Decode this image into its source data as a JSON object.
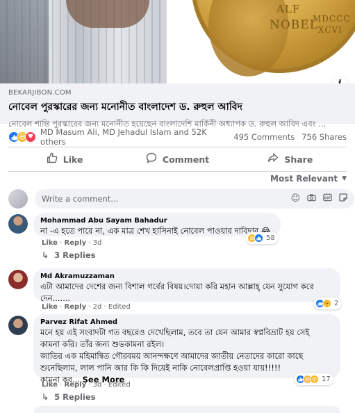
{
  "post": {
    "info_icon": "i",
    "link": {
      "domain": "BEKARJIBON.COM",
      "title": "নোবেল পুরস্কারের জন্য মনোনীত বাংলাদেশ ড. রুহুল আবিদ",
      "description": "নোবেল শান্তি পুরস্কারের জন্য মনোনীত হয়েছেন বাংলাদেশি মার্কিনী অধ্যাপক ড. রুহুল আবিদ এবং ..."
    },
    "hero": {
      "medal_text_1": "ALF",
      "medal_text_2": "NOBEL",
      "medal_text_3": "MDCCC",
      "medal_text_4": "XCVI"
    },
    "summary": {
      "names": "MD Masum Ali, MD Jehadul Islam and 52K others",
      "comments": "495 Comments",
      "shares": "756 Shares"
    },
    "actions": {
      "like": "Like",
      "comment": "Comment",
      "share": "Share"
    }
  },
  "sort": {
    "label": "Most Relevant"
  },
  "composer": {
    "placeholder": "Write a comment..."
  },
  "comments": [
    {
      "name": "Mohammad Abu Sayam Bahadur",
      "text": "না -এ হতে পারে না, এক মাত্র শেখ হাসিনাই নোবেল পাওয়ার দাবিদার 😂",
      "reactions": "58",
      "like": "Like",
      "reply": "Reply",
      "time": "3d",
      "replies": "3 Replies"
    },
    {
      "name": "Md Akramuzzaman",
      "text_line1": "এটা আমাদের দেশের জন্য বিশাল গর্বের বিষয়।দোয়া করি মহান আল্লাহ্ যেন সুযোগ করে",
      "text_line2": "দেন.......",
      "reactions": "2",
      "like": "Like",
      "reply": "Reply",
      "time": "2d",
      "edited": "Edited"
    },
    {
      "name": "Parvez Rifat Ahmed",
      "text_line1": "মনে হয় এই সংবাদটা গত বছরেও দেখেছিলাম, তবে তা যেন আমার স্বপ্নবিভ্রাট হয় সেই",
      "text_line2": "কামনা করি। তাঁর জন্য শুভকামনা রইল।",
      "text_line3": "জাতির এক মহিমান্বিত গৌরবময় আনন্দক্ষণে আমাদের জাতীয় নেতাদের কারো কাছে",
      "text_line4": "শুনেছিলাম, লাল পানি আর কি কি দিয়েই নাকি নোবেলপ্রাপ্তি হওয়া যায়!!!!!",
      "text_line5": "কামনা কর...",
      "see_more": "See More",
      "reactions": "17",
      "like": "Like",
      "reply": "Reply",
      "time": "3d",
      "edited": "Edited",
      "replies": "5 Replies"
    }
  ],
  "colors": {
    "like_blue": "#1877f2",
    "love_red": "#f33e58",
    "haha_yellow": "#f7b928",
    "secondary_text": "#65676b",
    "bubble_bg": "#f0f2f5"
  }
}
